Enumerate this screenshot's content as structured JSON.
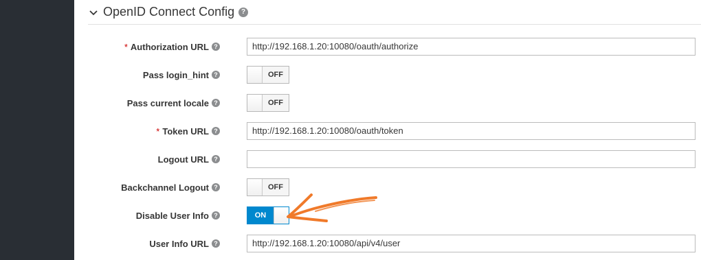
{
  "section": {
    "title": "OpenID Connect Config"
  },
  "fields": {
    "authorization_url": {
      "label": "Authorization URL",
      "required": "*",
      "value": "http://192.168.1.20:10080/oauth/authorize"
    },
    "pass_login_hint": {
      "label": "Pass login_hint",
      "state": "OFF"
    },
    "pass_current_locale": {
      "label": "Pass current locale",
      "state": "OFF"
    },
    "token_url": {
      "label": "Token URL",
      "required": "*",
      "value": "http://192.168.1.20:10080/oauth/token"
    },
    "logout_url": {
      "label": "Logout URL",
      "value": ""
    },
    "backchannel_logout": {
      "label": "Backchannel Logout",
      "state": "OFF"
    },
    "disable_user_info": {
      "label": "Disable User Info",
      "state": "ON"
    },
    "user_info_url": {
      "label": "User Info URL",
      "value": "http://192.168.1.20:10080/api/v4/user"
    }
  },
  "icons": {
    "help": "?"
  },
  "colors": {
    "accent": "#0088ce",
    "annotation": "#f07a2a",
    "sidebar": "#292e34"
  }
}
